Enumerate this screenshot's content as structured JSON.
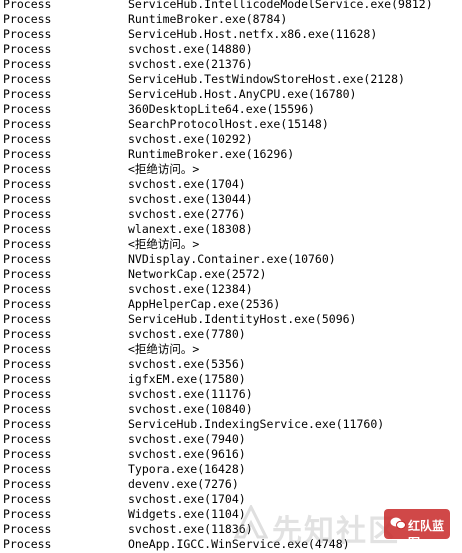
{
  "process_list": {
    "type_label": "Process",
    "rows": [
      "ServiceHub.IntellicodeModelService.exe(9812)",
      "RuntimeBroker.exe(8784)",
      "ServiceHub.Host.netfx.x86.exe(11628)",
      "svchost.exe(14880)",
      "svchost.exe(21376)",
      "ServiceHub.TestWindowStoreHost.exe(2128)",
      "ServiceHub.Host.AnyCPU.exe(16780)",
      "360DesktopLite64.exe(15596)",
      "SearchProtocolHost.exe(15148)",
      "svchost.exe(10292)",
      "RuntimeBroker.exe(16296)",
      "<拒绝访问。>",
      "svchost.exe(1704)",
      "svchost.exe(13044)",
      "svchost.exe(2776)",
      "wlanext.exe(18308)",
      "<拒绝访问。>",
      "NVDisplay.Container.exe(10760)",
      "NetworkCap.exe(2572)",
      "svchost.exe(12384)",
      "AppHelperCap.exe(2536)",
      "ServiceHub.IdentityHost.exe(5096)",
      "svchost.exe(7780)",
      "<拒绝访问。>",
      "svchost.exe(5356)",
      "igfxEM.exe(17580)",
      "svchost.exe(11176)",
      "svchost.exe(10840)",
      "ServiceHub.IndexingService.exe(11760)",
      "svchost.exe(7940)",
      "svchost.exe(9616)",
      "Typora.exe(16428)",
      "devenv.exe(7276)",
      "svchost.exe(1704)",
      "Widgets.exe(1104)",
      "svchost.exe(11836)",
      "OneApp.IGCC.WinService.exe(4748)"
    ]
  },
  "watermark": {
    "site_text": "先知社区",
    "badge_text": "红队蓝军",
    "badge_color": "#c82828",
    "logo_icon": "fox-logo-icon"
  }
}
